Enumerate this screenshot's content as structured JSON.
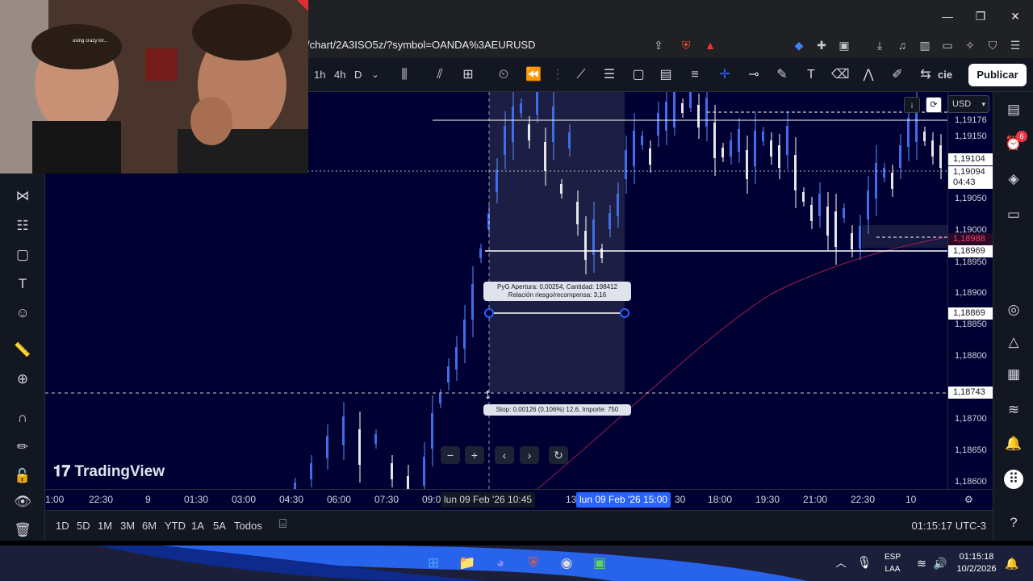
{
  "browser": {
    "url": "/chart/2A3ISO5z/?symbol=OANDA%3AEURUSD",
    "icons": [
      "share-icon",
      "brave-shield-icon",
      "brave-rewards-icon",
      "extension-icon",
      "puzzle-icon",
      "screenshot-icon",
      "download-icon",
      "music-icon",
      "sidebar-icon",
      "wallet-icon",
      "leo-icon",
      "vpn-icon",
      "menu-icon"
    ]
  },
  "toolbar": {
    "timeframes": [
      "1h",
      "4h",
      "D"
    ],
    "partial_label": "cie",
    "publish_label": "Publicar"
  },
  "price_scale": {
    "currency": "USD",
    "labels": [
      "1,19176",
      "1,19150",
      "1,19104",
      "1,19094",
      "04:43",
      "1,19050",
      "1,19000",
      "1,18988",
      "1,18969",
      "1,18950",
      "1,18900",
      "1,18869",
      "1,18850",
      "1,18800",
      "1,18743",
      "1,18700",
      "1,18650",
      "1,18600"
    ]
  },
  "time_axis": {
    "labels": [
      "1:00",
      "22:30",
      "9",
      "01:30",
      "03:00",
      "04:30",
      "06:00",
      "07:30",
      "09:0",
      "13",
      "30",
      "18:00",
      "19:30",
      "21:00",
      "22:30",
      "10"
    ],
    "cursor_left": "lun 09 Feb '26  10:45",
    "cursor_right": "lun 09 Feb '26  15:00"
  },
  "position_tool": {
    "label_line1": "PyG Apertura: 0,00254, Cantidad: 198412",
    "label_line2": "Relación riesgo/recompensa: 3,16",
    "stop_label": "Stop: 0,00126 (0,106%) 12,6, Importe: 750"
  },
  "bottom_bar": {
    "ranges": [
      "1D",
      "5D",
      "1M",
      "3M",
      "6M",
      "YTD",
      "1A",
      "5A",
      "Todos"
    ],
    "clock": "01:15:17 UTC-3"
  },
  "right_toolbar": {
    "alert_badge": "6"
  },
  "taskbar": {
    "lang_top": "ESP",
    "lang_bottom": "LAA",
    "time": "01:15:18",
    "date": "10/2/2026"
  },
  "webcam": {
    "overlay_text": "using crazy lor..."
  },
  "colors": {
    "chart_bg": "#000032",
    "candle": "#5b8cff",
    "accent": "#2962ff",
    "ma_line": "#a0204a",
    "stop_tag": "#ff3b5c"
  }
}
